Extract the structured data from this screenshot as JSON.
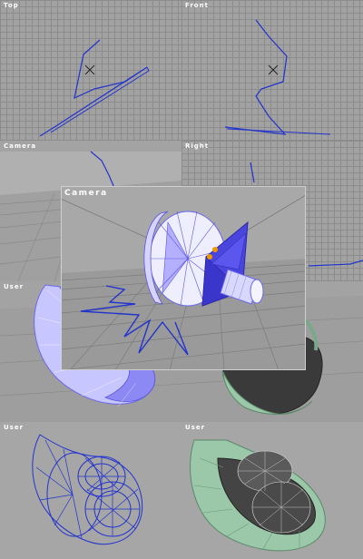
{
  "viewports": {
    "top": {
      "label": "Top"
    },
    "front": {
      "label": "Front"
    },
    "camera_small": {
      "label": "Camera"
    },
    "right": {
      "label": "Right"
    },
    "camera_main": {
      "label": "Camera"
    },
    "user_shaded": {
      "label": "User"
    },
    "user_wire": {
      "label": "User"
    },
    "user_textured": {
      "label": "User"
    }
  },
  "colors": {
    "wire": "#2233cc",
    "grid_bg": "#a2a2a2",
    "grid_line": "#8c8c8c",
    "label": "#ffffff",
    "mesh_blue": "#6a66ee",
    "mesh_light": "#e6e6ff",
    "mesh_green": "#9ac8a8",
    "mesh_dark": "#3a3a3a",
    "handle": "#ee9900"
  },
  "icons": {
    "pivot": "cross-marker-icon",
    "selection": "vertex-handle-icon"
  }
}
